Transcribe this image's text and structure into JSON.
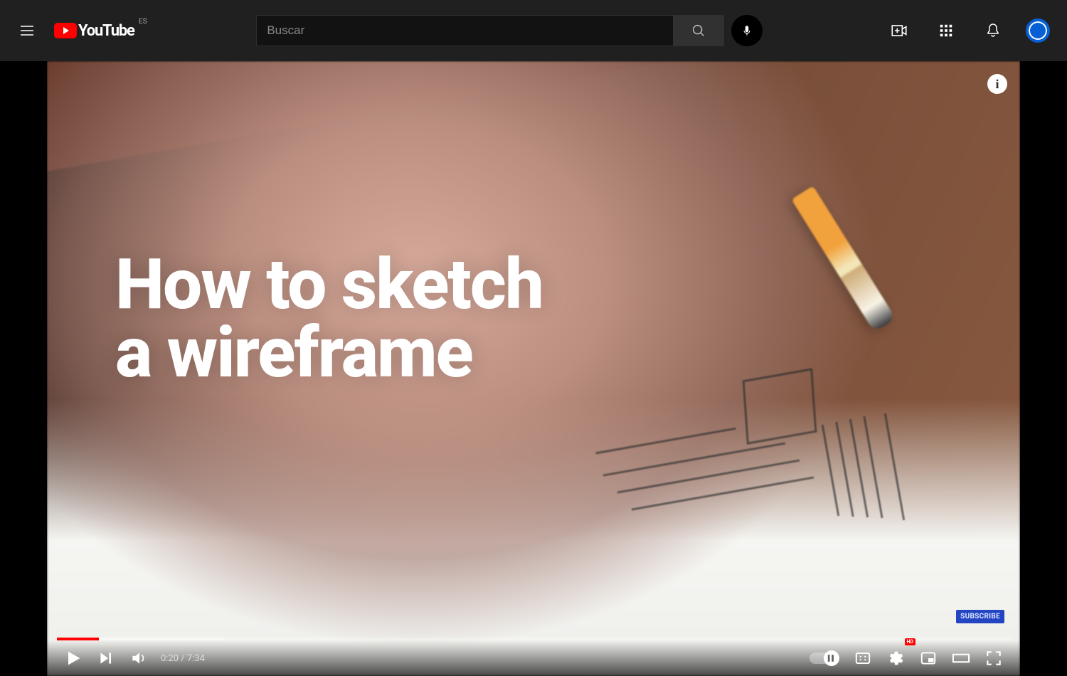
{
  "header": {
    "logo_text": "YouTube",
    "lang_code": "ES",
    "search_placeholder": "Buscar"
  },
  "video": {
    "caption_line1": "How to sketch",
    "caption_line2": "a wireframe",
    "subscribe_label": "SUBSCRIBE"
  },
  "player": {
    "current_time": "0:20",
    "duration": "7:34",
    "time_separator": " / ",
    "progress_played_pct": 4.4,
    "progress_buffered_pct": 17.5,
    "hd_badge": "HD",
    "autoplay_on": true
  },
  "colors": {
    "brand_red": "#ff0000",
    "accent_blue": "#065fd4",
    "subscribe_blue": "#2345c2"
  }
}
